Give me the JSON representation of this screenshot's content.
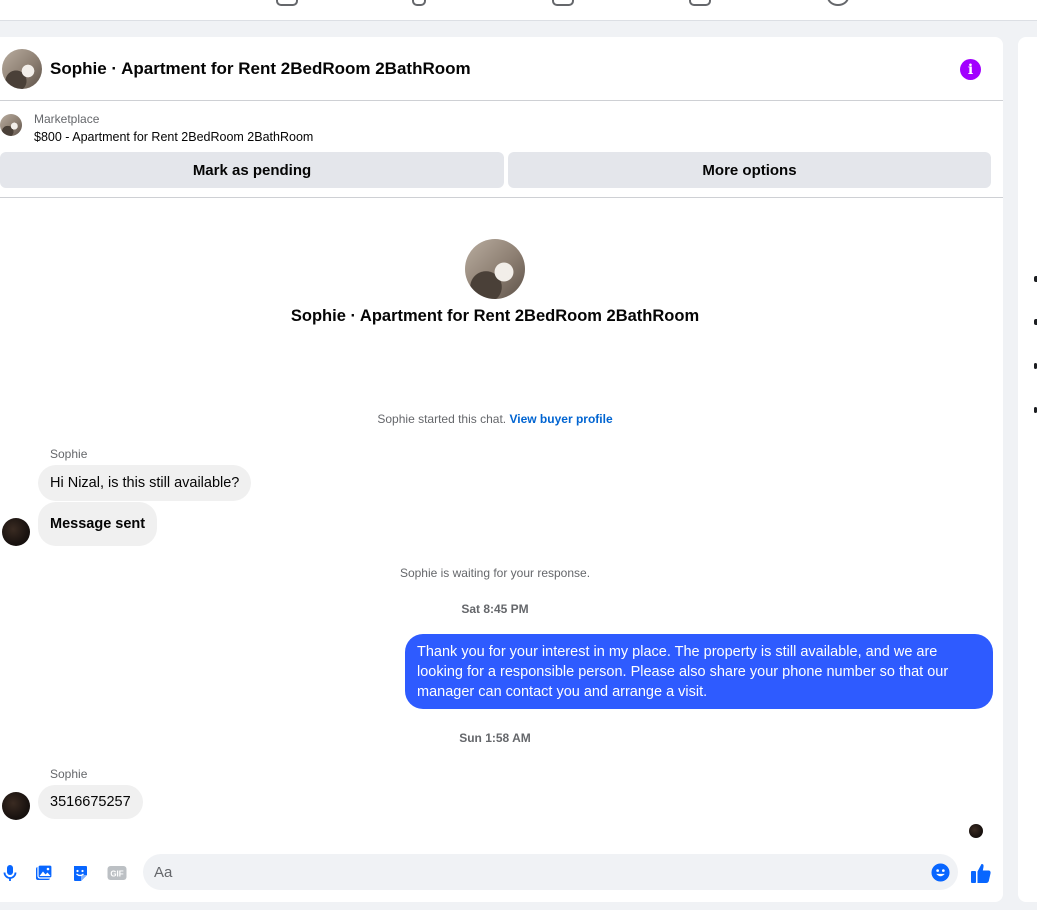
{
  "conversation": {
    "title": "Sophie · Apartment for Rent 2BedRoom 2BathRoom"
  },
  "marketplace": {
    "label": "Marketplace",
    "listing": "$800 - Apartment for Rent 2BedRoom 2BathRoom",
    "pending_button": "Mark as pending",
    "more_button": "More options"
  },
  "intro": {
    "title": "Sophie · Apartment for Rent 2BedRoom 2BathRoom",
    "started_text": "Sophie started this chat.",
    "profile_link": "View buyer profile"
  },
  "messages": {
    "first_sender": "Sophie",
    "first_text": "Hi Nizal, is this still available?",
    "sent_notice": "Message sent",
    "waiting": "Sophie is waiting for your response.",
    "time_1": "Sat 8:45 PM",
    "reply": "Thank you for your interest in my place. The property is still available, and we are looking for a responsible person. Please also share your phone number so that our manager can contact you and arrange a visit.",
    "time_2": "Sun 1:58 AM",
    "second_sender": "Sophie",
    "second_text": "3516675257"
  },
  "composer": {
    "placeholder": "Aa"
  },
  "colors": {
    "accent": "#2e5bff",
    "info": "#a200ff",
    "link": "#0064d1",
    "like": "#0866ff"
  }
}
